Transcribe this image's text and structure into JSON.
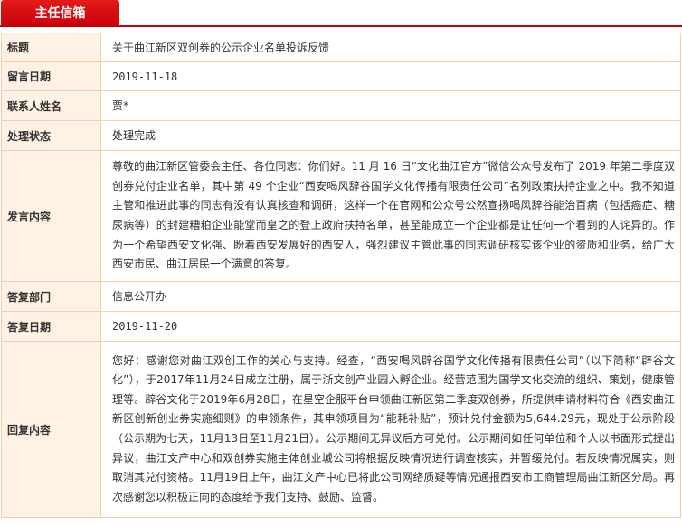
{
  "header": {
    "title": "主任信箱"
  },
  "fields": {
    "subject": {
      "label": "标题",
      "value": "关于曲江新区双创券的公示企业名单投诉反馈"
    },
    "msg_date": {
      "label": "留言日期",
      "value": "2019-11-18"
    },
    "contact": {
      "label": "联系人姓名",
      "value": "贾*"
    },
    "status": {
      "label": "处理状态",
      "value": "处理完成"
    },
    "content": {
      "label": "发言内容",
      "value": "尊敬的曲江新区管委会主任、各位同志：你们好。11 月 16 日“文化曲江官方”微信公众号发布了 2019 年第二季度双创券兑付企业名单，其中第 49 个企业“西安喝风辞谷国学文化传播有限责任公司”名列政策扶持企业之中。我不知道主管和推进此事的同志有没有认真核查和调研，这样一个在官网和公众号公然宣扬喝风辞谷能治百病（包括癌症、糖尿病等）的封建糟粕企业能堂而皇之的登上政府扶持名单，甚至能成立一个企业都是让任何一个看到的人诧异的。作为一个希望西安文化强、盼着西安发展好的西安人，强烈建议主管此事的同志调研核实该企业的资质和业务，给广大西安市民、曲江居民一个满意的答复。"
    },
    "reply_dept": {
      "label": "答复部门",
      "value": "信息公开办"
    },
    "reply_date": {
      "label": "答复日期",
      "value": "2019-11-20"
    },
    "reply": {
      "label": "回复内容",
      "value": "您好：感谢您对曲江双创工作的关心与支持。经查，“西安喝风辟谷国学文化传播有限责任公司”（以下简称“辟谷文化”），于2017年11月24日成立注册，属于浙文创产业园入孵企业。经营范围为国学文化交流的组织、策划，健康管理等。辟谷文化于2019年6月28日，在星空企服平台申领曲江新区第二季度双创券，所提供申请材料符合《西安曲江新区创新创业券实施细则》的申领条件，其申领项目为“能耗补贴”，预计兑付金额为5,644.29元，现处于公示阶段（公示期为七天，11月13日至11月21日）。公示期间无异议后方可兑付。公示期间如任何单位和个人以书面形式提出异议，曲江文产中心和双创券实施主体创业城公司将根据反映情况进行调查核实，并暂缓兑付。若反映情况属实，则取消其兑付资格。11月19日上午，曲江文产中心已将此公司网络质疑等情况通报西安市工商管理局曲江新区分局。再次感谢您以积极正向的态度给予我们支持、鼓励、监督。"
    }
  }
}
